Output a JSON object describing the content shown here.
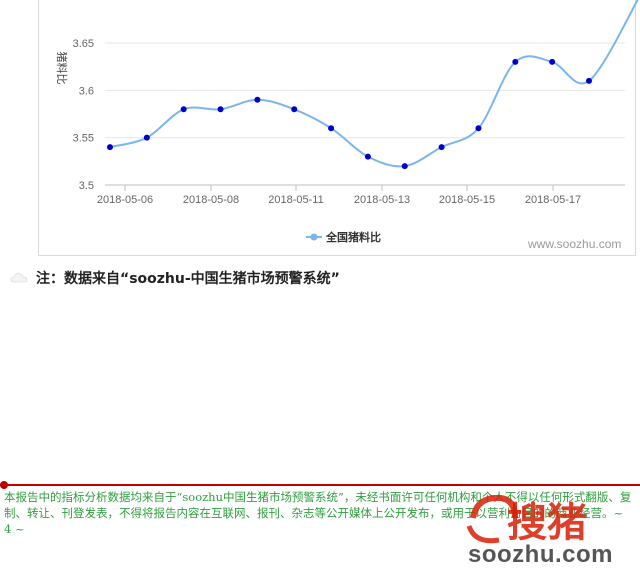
{
  "chart_data": {
    "type": "line",
    "ylabel": "猪料比",
    "ylim": [
      3.5,
      3.7
    ],
    "yticks": [
      3.5,
      3.55,
      3.6,
      3.65
    ],
    "x_tick_labels": [
      "2018-05-06",
      "2018-05-08",
      "2018-05-11",
      "2018-05-13",
      "2018-05-15",
      "2018-05-17"
    ],
    "legend": "bottom-center",
    "grid": true,
    "series": [
      {
        "name": "全国猪料比",
        "color": "#7cb5ec",
        "marker_color": "#0000cc",
        "values": [
          3.54,
          3.55,
          3.58,
          3.58,
          3.59,
          3.58,
          3.56,
          3.53,
          3.52,
          3.54,
          3.56,
          3.63,
          3.63,
          3.61,
          3.7
        ]
      }
    ]
  },
  "watermark": "www.soozhu.com",
  "note": "注：数据来自“soozhu-中国生猪市场预警系统”",
  "footer": {
    "text": "本报告中的指标分析数据均来自于“soozhu中国生猪市场预警系统”，未经书面许可任何机构和个人不得以任何形式翻版、复制、转让、刊登发表，不得将报告内容在互联网、报刊、杂志等公开媒体上公开发布，或用于以营利为目的的商业经营。~ 4 ~",
    "logo_text": "搜猪",
    "logo_site": "soozhu.com"
  }
}
